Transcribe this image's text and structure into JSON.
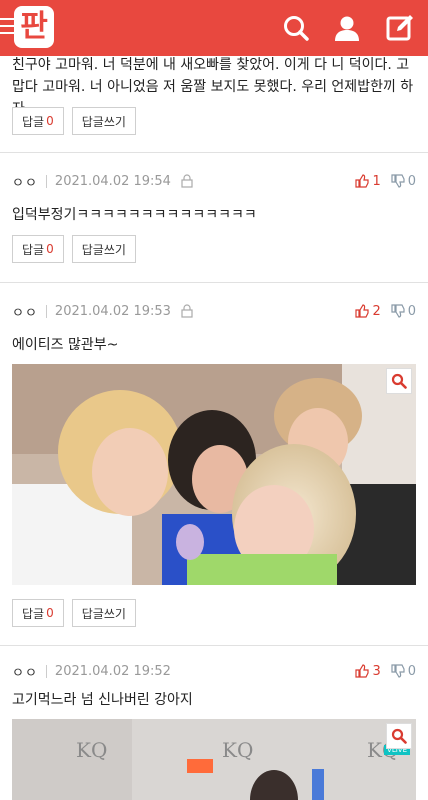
{
  "header": {
    "logo_text": "판",
    "accent": "#e8483f",
    "icons": [
      "menu-icon",
      "search-icon",
      "user-icon",
      "write-icon"
    ]
  },
  "comments": [
    {
      "text": "친구야 고마워. 너 덕분에 내 새오빠를 찾았어. 이게 다 니 덕이다. 고맙다 고마워. 너 아니었음 저 움짤 보지도 못했다. 우리 언제밥한끼 하자",
      "reply_label": "답글",
      "reply_count": "0",
      "write_reply_label": "답글쓰기"
    },
    {
      "nickname": "ㅇㅇ",
      "date": "2021.04.02 19:54",
      "up": "1",
      "down": "0",
      "text": "입덕부정기ㅋㅋㅋㅋㅋㅋㅋㅋㅋㅋㅋㅋㅋㅋ",
      "reply_label": "답글",
      "reply_count": "0",
      "write_reply_label": "답글쓰기"
    },
    {
      "nickname": "ㅇㅇ",
      "date": "2021.04.02 19:53",
      "up": "2",
      "down": "0",
      "text": "에이티즈 많관부~",
      "reply_label": "답글",
      "reply_count": "0",
      "write_reply_label": "답글쓰기"
    },
    {
      "nickname": "ㅇㅇ",
      "date": "2021.04.02 19:52",
      "up": "3",
      "down": "0",
      "text": "고기먹느라 넘 신나버린 강아지",
      "image_text": "VLIVE"
    }
  ]
}
